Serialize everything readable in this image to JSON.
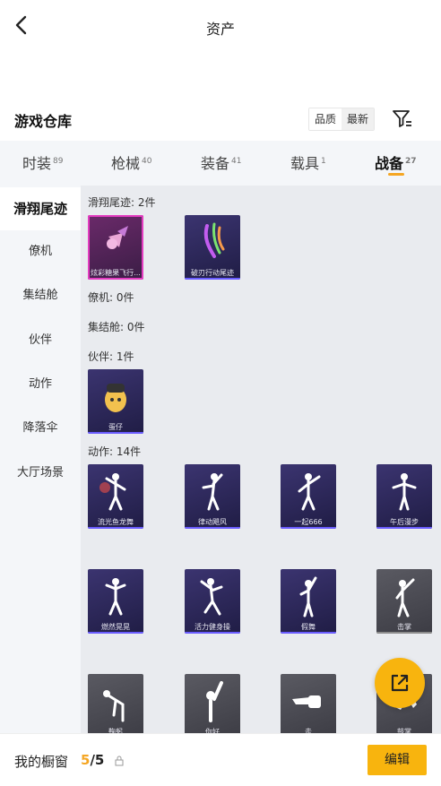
{
  "header": {
    "title": "资产"
  },
  "warehouse": {
    "title": "游戏仓库",
    "sort": {
      "quality_label": "品质",
      "latest_label": "最新"
    }
  },
  "tabs": [
    {
      "label": "时装",
      "count": "89"
    },
    {
      "label": "枪械",
      "count": "40"
    },
    {
      "label": "装备",
      "count": "41"
    },
    {
      "label": "载具",
      "count": "1"
    },
    {
      "label": "战备",
      "count": "27"
    }
  ],
  "sidebar": {
    "items": [
      {
        "label": "滑翔尾迹"
      },
      {
        "label": "僚机"
      },
      {
        "label": "集结舱"
      },
      {
        "label": "伙伴"
      },
      {
        "label": "动作"
      },
      {
        "label": "降落伞"
      },
      {
        "label": "大厅场景"
      }
    ]
  },
  "sections": {
    "trail": {
      "label": "滑翔尾迹: 2件",
      "items": [
        {
          "name": "炫彩糖果飞行..."
        },
        {
          "name": "破刃行动尾迹"
        }
      ]
    },
    "wingman": {
      "label": "僚机: 0件"
    },
    "pod": {
      "label": "集结舱: 0件"
    },
    "partner": {
      "label": "伙伴: 1件",
      "items": [
        {
          "name": "蛋仔"
        }
      ]
    },
    "emote": {
      "label": "动作: 14件",
      "items": [
        {
          "name": "流光鱼龙舞"
        },
        {
          "name": "律动飓风"
        },
        {
          "name": "一起666"
        },
        {
          "name": "午后漫步"
        },
        {
          "name": "燃然晃晃"
        },
        {
          "name": "活力健身操"
        },
        {
          "name": "假舞"
        },
        {
          "name": "击掌"
        },
        {
          "name": "鞠躬"
        },
        {
          "name": "你好"
        },
        {
          "name": "走"
        },
        {
          "name": "鼓掌"
        }
      ]
    }
  },
  "bottom": {
    "showcase_label": "我的橱窗",
    "count_current": "5",
    "count_total": "/5",
    "edit_label": "编辑"
  },
  "colors": {
    "accent": "#f8b40e",
    "purple_card": "#2c2757",
    "gray_card": "#4a4a52",
    "pink_card": "#e33cc0"
  },
  "icons": [
    "back-arrow-icon",
    "filter-icon",
    "lock-icon",
    "share-external-icon"
  ]
}
